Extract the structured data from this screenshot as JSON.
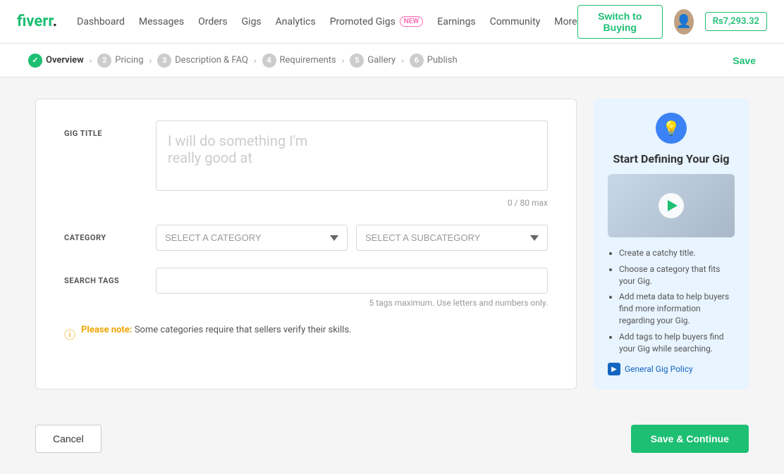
{
  "header": {
    "logo_text": "fiverr",
    "logo_dot": ".",
    "nav": [
      {
        "label": "Dashboard",
        "id": "dashboard"
      },
      {
        "label": "Messages",
        "id": "messages"
      },
      {
        "label": "Orders",
        "id": "orders"
      },
      {
        "label": "Gigs",
        "id": "gigs"
      },
      {
        "label": "Analytics",
        "id": "analytics"
      },
      {
        "label": "Promoted Gigs",
        "id": "promoted-gigs"
      },
      {
        "label": "NEW",
        "id": "new-badge"
      },
      {
        "label": "Earnings",
        "id": "earnings"
      },
      {
        "label": "Community",
        "id": "community"
      },
      {
        "label": "More",
        "id": "more"
      }
    ],
    "switch_buying": "Switch to Buying",
    "balance": "Rs7,293.32"
  },
  "breadcrumb": {
    "steps": [
      {
        "num": "✓",
        "label": "Overview",
        "active": true
      },
      {
        "num": "2",
        "label": "Pricing",
        "active": false
      },
      {
        "num": "3",
        "label": "Description & FAQ",
        "active": false
      },
      {
        "num": "4",
        "label": "Requirements",
        "active": false
      },
      {
        "num": "5",
        "label": "Gallery",
        "active": false
      },
      {
        "num": "6",
        "label": "Publish",
        "active": false
      }
    ],
    "save_label": "Save"
  },
  "form": {
    "gig_title_label": "GIG TITLE",
    "gig_title_placeholder": "I will do something I'm\nreally good at",
    "char_count": "0 / 80 max",
    "category_label": "CATEGORY",
    "category_placeholder": "SELECT A CATEGORY",
    "subcategory_placeholder": "SELECT A SUBCATEGORY",
    "search_tags_label": "SEARCH TAGS",
    "search_tags_hint": "5 tags maximum. Use letters and numbers only.",
    "notice_bold": "Please note:",
    "notice_text": " Some categories require that sellers verify their skills."
  },
  "sidebar": {
    "title": "Start Defining Your Gig",
    "lightbulb": "💡",
    "bullets": [
      "Create a catchy title.",
      "Choose a category that fits your Gig.",
      "Add meta data to help buyers find more information regarding your Gig.",
      "Add tags to help buyers find your Gig while searching."
    ],
    "policy_link": "General Gig Policy"
  },
  "actions": {
    "cancel": "Cancel",
    "save_continue": "Save & Continue"
  }
}
